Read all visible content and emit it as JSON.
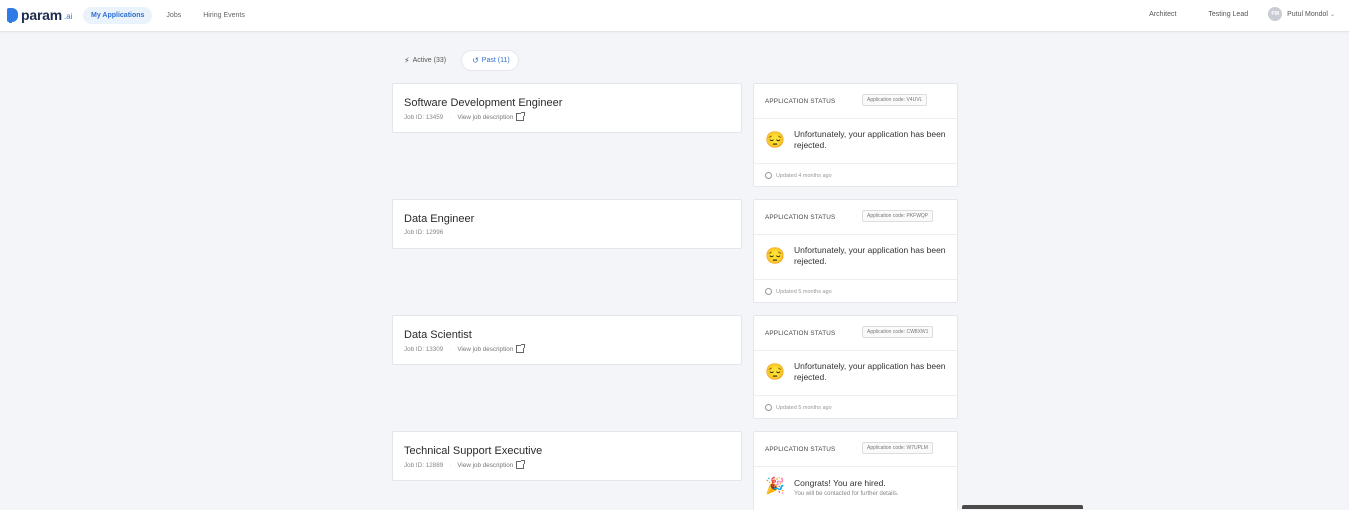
{
  "header": {
    "logo_text": "param",
    "logo_suffix": ".ai",
    "nav": [
      "My Applications",
      "Jobs",
      "Hiring Events"
    ],
    "right_links": [
      "Architect",
      "Testing Lead"
    ],
    "user": {
      "initials": "PM",
      "name": "Putul Mondol"
    }
  },
  "tabs": [
    {
      "label": "Active (33)",
      "icon": "bolt-icon"
    },
    {
      "label": "Past (11)",
      "icon": "history-icon"
    }
  ],
  "applications": [
    {
      "title": "Software Development Engineer",
      "job_id": "Job ID: 13459",
      "view": "View job description",
      "status_head": "APPLICATION STATUS",
      "code": "Application code: V4UVL",
      "emoji": "😔",
      "status": "Unfortunately, your application has been rejected.",
      "updated": "Updated 4 months ago"
    },
    {
      "title": "Data Engineer",
      "job_id": "Job ID: 12996",
      "status_head": "APPLICATION STATUS",
      "code": "Application code: PKFWQP",
      "emoji": "😔",
      "status": "Unfortunately, your application has been rejected.",
      "updated": "Updated 5 months ago"
    },
    {
      "title": "Data Scientist",
      "job_id": "Job ID: 13309",
      "view": "View job description",
      "status_head": "APPLICATION STATUS",
      "code": "Application code: CW8XW1",
      "emoji": "😔",
      "status": "Unfortunately, your application has been rejected.",
      "updated": "Updated 5 months ago"
    },
    {
      "title": "Technical Support Executive",
      "job_id": "Job ID: 12889",
      "view": "View job description",
      "status_head": "APPLICATION STATUS",
      "code": "Application code: W7UPLM",
      "emoji": "🎉",
      "status": "Congrats! You are hired.",
      "sub": "You will be contacted for further details."
    }
  ]
}
